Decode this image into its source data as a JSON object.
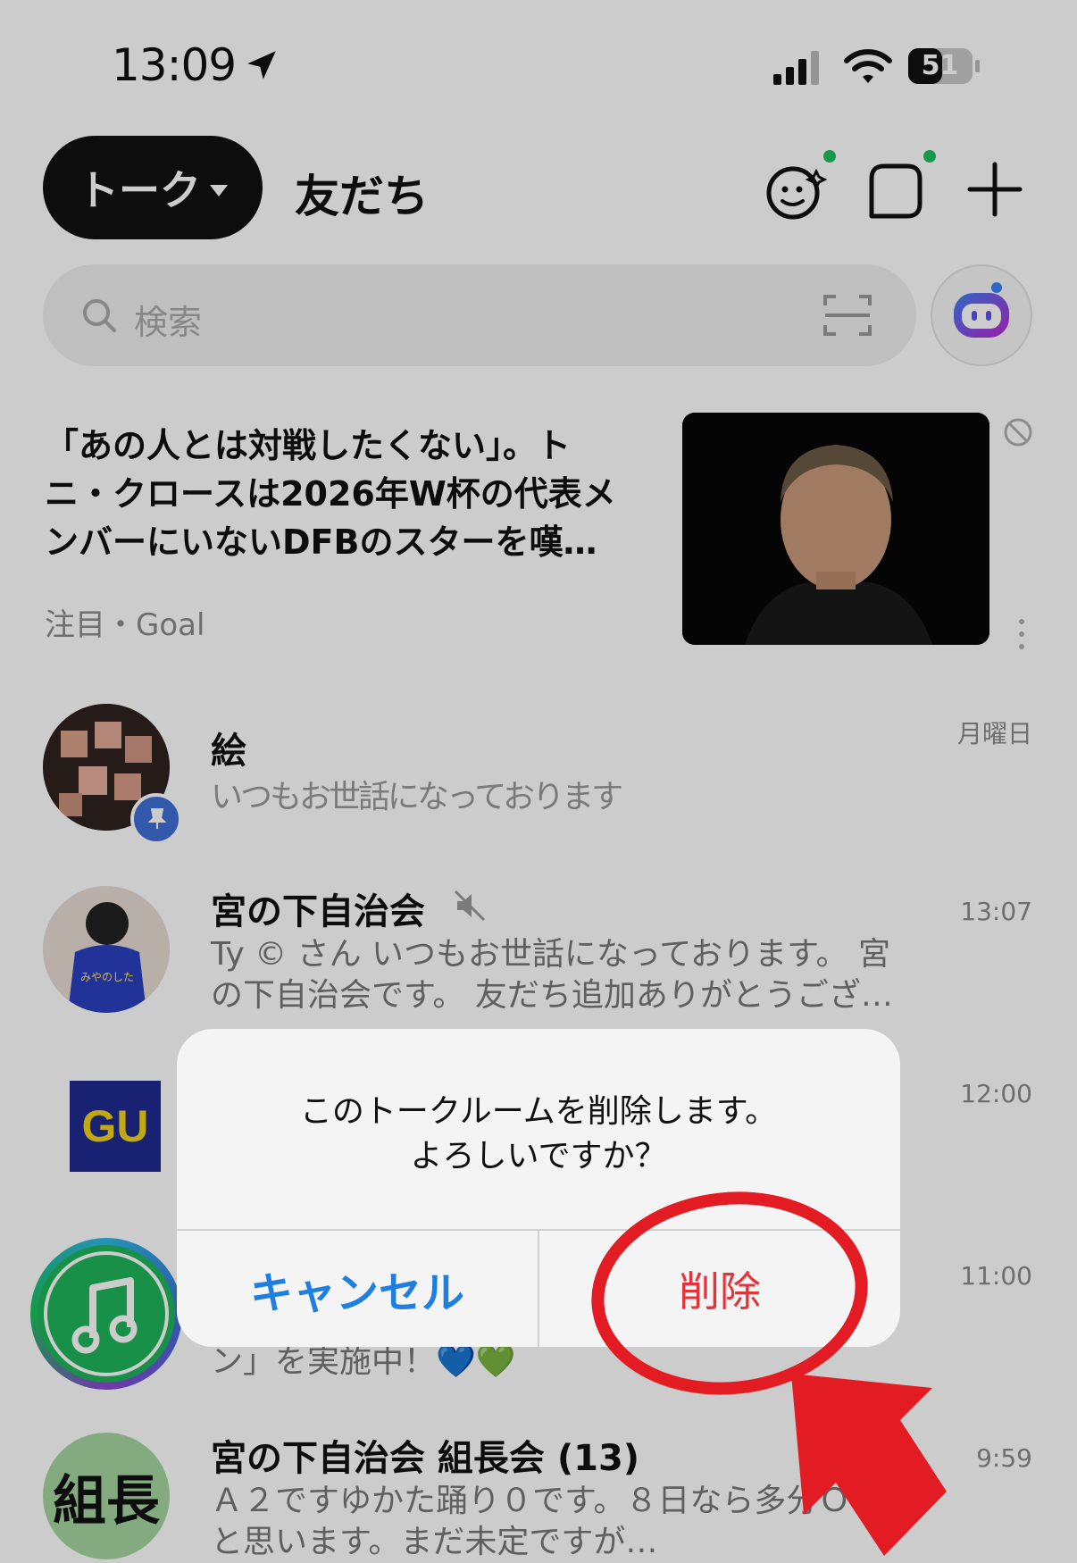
{
  "status_bar": {
    "time": "13:09",
    "battery": "51"
  },
  "header": {
    "talk_tab": "トーク",
    "friends_tab": "友だち"
  },
  "search": {
    "placeholder": "検索"
  },
  "news": {
    "title": "「あの人とは対戦したくない」。トニ・クロースは2026年W杯の代表メンバーにいないDFBのスターを嘆…",
    "source": "注目・Goal"
  },
  "chats": [
    {
      "name": "絵",
      "message": "いつもお世話になっております",
      "time": "月曜日"
    },
    {
      "name": "宮の下自治会",
      "message": "Ty © さん いつもお世話になっております。 宮の下自治会です。 友だち追加ありがとうござ…",
      "time": "13:07"
    },
    {
      "name": "",
      "message": "",
      "time": "12:00",
      "logo": "GU"
    },
    {
      "name": "",
      "message": "ン」を実施中！💙💚",
      "time": "11:00"
    },
    {
      "name": "宮の下自治会 組長会 (13)",
      "message": "Ａ２ですゆかた踊り０です。８日なら多分ＯＫと思います。まだ未定ですが…",
      "time": "9:59",
      "avatar_text": "組長"
    }
  ],
  "dialog": {
    "message_line1": "このトークルームを削除します。",
    "message_line2": "よろしいですか？",
    "cancel_label": "キャンセル",
    "delete_label": "削除"
  },
  "colors": {
    "cancel": "#1f7fe0",
    "delete": "#e3343a",
    "annotation": "#e31b23",
    "online_dot": "#19c15b"
  }
}
